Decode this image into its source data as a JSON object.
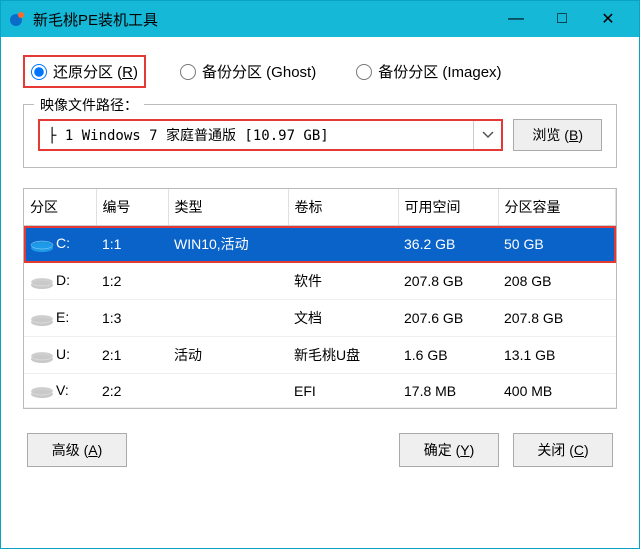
{
  "title": "新毛桃PE装机工具",
  "titlebar": {
    "minimize": "—",
    "maximize": "□",
    "close": "✕"
  },
  "modes": {
    "restore": "还原分区 (R)",
    "backup_ghost": "备份分区 (Ghost)",
    "backup_imagex": "备份分区 (Imagex)"
  },
  "image_group": {
    "legend": "映像文件路径：",
    "selected": "├ 1 Windows 7 家庭普通版 [10.97 GB]",
    "browse": "浏览 (B)"
  },
  "table": {
    "headers": [
      "分区",
      "编号",
      "类型",
      "卷标",
      "可用空间",
      "分区容量"
    ],
    "rows": [
      {
        "letter": "C:",
        "num": "1:1",
        "type": "WIN10,活动",
        "label": "",
        "free": "36.2 GB",
        "size": "50 GB",
        "selected": true,
        "iconColor": "#1e9be8"
      },
      {
        "letter": "D:",
        "num": "1:2",
        "type": "",
        "label": "软件",
        "free": "207.8 GB",
        "size": "208 GB",
        "selected": false,
        "iconColor": "#c9c9c9"
      },
      {
        "letter": "E:",
        "num": "1:3",
        "type": "",
        "label": "文档",
        "free": "207.6 GB",
        "size": "207.8 GB",
        "selected": false,
        "iconColor": "#c9c9c9"
      },
      {
        "letter": "U:",
        "num": "2:1",
        "type": "活动",
        "label": "新毛桃U盘",
        "free": "1.6 GB",
        "size": "13.1 GB",
        "selected": false,
        "iconColor": "#c9c9c9"
      },
      {
        "letter": "V:",
        "num": "2:2",
        "type": "",
        "label": "EFI",
        "free": "17.8 MB",
        "size": "400 MB",
        "selected": false,
        "iconColor": "#c9c9c9"
      }
    ]
  },
  "footer": {
    "advanced": "高级 (A)",
    "ok": "确定 (Y)",
    "close": "关闭 (C)"
  },
  "col_widths": [
    "72px",
    "72px",
    "120px",
    "110px",
    "100px",
    "auto"
  ]
}
